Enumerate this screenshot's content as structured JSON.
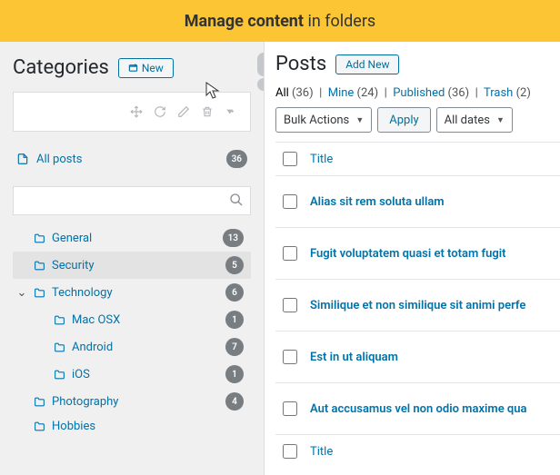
{
  "banner": {
    "strong": "Manage content",
    "rest": " in folders"
  },
  "sidebar": {
    "title": "Categories",
    "new_btn": "New",
    "all_posts": {
      "label": "All posts",
      "count": "36"
    },
    "search_placeholder": "",
    "tree": [
      {
        "label": "General",
        "count": "13",
        "depth": 0,
        "arrow": ""
      },
      {
        "label": "Security",
        "count": "5",
        "depth": 0,
        "arrow": "",
        "selected": true
      },
      {
        "label": "Technology",
        "count": "6",
        "depth": 0,
        "arrow": "⌄"
      },
      {
        "label": "Mac OSX",
        "count": "1",
        "depth": 1,
        "arrow": ""
      },
      {
        "label": "Android",
        "count": "7",
        "depth": 1,
        "arrow": ""
      },
      {
        "label": "iOS",
        "count": "1",
        "depth": 1,
        "arrow": ""
      },
      {
        "label": "Photography",
        "count": "4",
        "depth": 0,
        "arrow": ""
      },
      {
        "label": "Hobbies",
        "count": "",
        "depth": 0,
        "arrow": ""
      }
    ]
  },
  "main": {
    "title": "Posts",
    "add_btn": "Add New",
    "filters": {
      "all": "All",
      "all_count": "(36)",
      "mine": "Mine",
      "mine_count": "(24)",
      "pub": "Published",
      "pub_count": "(36)",
      "trash": "Trash",
      "trash_count": "(2)"
    },
    "bulk": "Bulk Actions",
    "apply": "Apply",
    "dates": "All dates",
    "col_title": "Title",
    "posts": [
      "Alias sit rem soluta ullam",
      "Fugit voluptatem quasi et totam fugit",
      "Similique et non similique sit animi perfe",
      "Est in ut aliquam",
      "Aut accusamus vel non odio maxime qua"
    ],
    "col_title_foot": "Title"
  }
}
